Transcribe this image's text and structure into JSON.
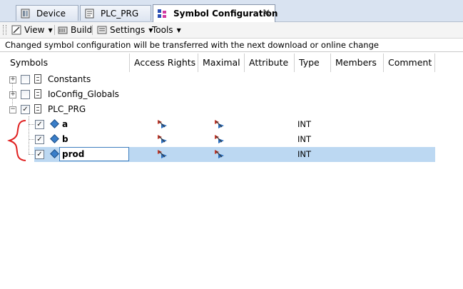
{
  "tabs": [
    {
      "label": "Device",
      "icon": "device-icon"
    },
    {
      "label": "PLC_PRG",
      "icon": "pou-icon"
    },
    {
      "label": "Symbol Configuration",
      "icon": "symbol-config-icon",
      "active": true
    }
  ],
  "toolbar": {
    "view_label": "View",
    "build_label": "Build",
    "settings_label": "Settings",
    "tools_label": "Tools"
  },
  "info_message": "Changed symbol configuration will be transferred with the next download or online change",
  "columns": [
    "Symbols",
    "Access Rights",
    "Maximal",
    "Attribute",
    "Type",
    "Members",
    "Comment"
  ],
  "tree": {
    "groups": [
      {
        "label": "Constants",
        "expanded": false,
        "checked": false
      },
      {
        "label": "IoConfig_Globals",
        "expanded": false,
        "checked": false
      },
      {
        "label": "PLC_PRG",
        "expanded": true,
        "checked": true
      }
    ],
    "variables": [
      {
        "name": "a",
        "type": "INT",
        "checked": true,
        "selected": false
      },
      {
        "name": "b",
        "type": "INT",
        "checked": true,
        "selected": false
      },
      {
        "name": "prod",
        "type": "INT",
        "checked": true,
        "selected": true
      }
    ]
  },
  "colors": {
    "selection": "#bcd8f2",
    "annotation_brace": "#e02020",
    "tab_strip": "#d9e3f1"
  }
}
